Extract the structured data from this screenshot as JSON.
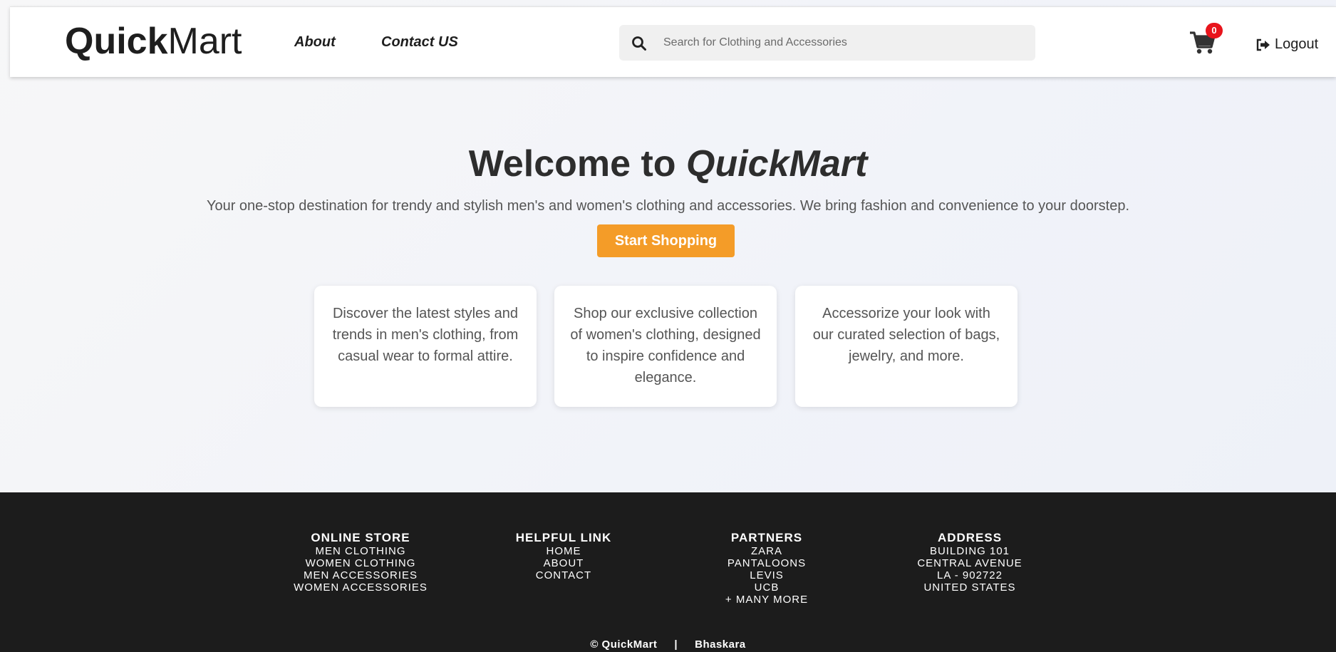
{
  "header": {
    "logo_bold": "Quick",
    "logo_light": "Mart",
    "nav": {
      "about": "About",
      "contact": "Contact US"
    },
    "search": {
      "placeholder": "Search for Clothing and Accessories",
      "icon": "search-icon"
    },
    "cart": {
      "icon": "shopping-cart-icon",
      "count": "0",
      "badge_color": "#e8141c"
    },
    "logout": {
      "icon": "sign-out-icon",
      "label": "Logout"
    }
  },
  "hero": {
    "title_prefix": "Welcome to ",
    "title_brand": "QuickMart",
    "subtitle": "Your one-stop destination for trendy and stylish men's and women's clothing and accessories. We bring fashion and convenience to your doorstep.",
    "cta_label": "Start Shopping",
    "cta_color": "#f49c28"
  },
  "cards": [
    {
      "text": "Discover the latest styles and trends in men's clothing, from casual wear to formal attire."
    },
    {
      "text": "Shop our exclusive collection of women's clothing, designed to inspire confidence and elegance."
    },
    {
      "text": "Accessorize your look with our curated selection of bags, jewelry, and more."
    }
  ],
  "footer": {
    "background": "#1c1c1c",
    "columns": [
      {
        "title": "ONLINE STORE",
        "items": [
          "MEN CLOTHING",
          "WOMEN CLOTHING",
          "MEN ACCESSORIES",
          "WOMEN ACCESSORIES"
        ]
      },
      {
        "title": "HELPFUL LINK",
        "items": [
          "HOME",
          "ABOUT",
          "CONTACT"
        ]
      },
      {
        "title": "PARTNERS",
        "items": [
          "ZARA",
          "PANTALOONS",
          "LEVIS",
          "UCB",
          "+ MANY MORE"
        ]
      },
      {
        "title": "ADDRESS",
        "items": [
          "BUILDING 101",
          "CENTRAL AVENUE",
          "LA - 902722",
          "UNITED STATES"
        ]
      }
    ],
    "copyright": "© QuickMart",
    "separator": "|",
    "author": "Bhaskara"
  }
}
